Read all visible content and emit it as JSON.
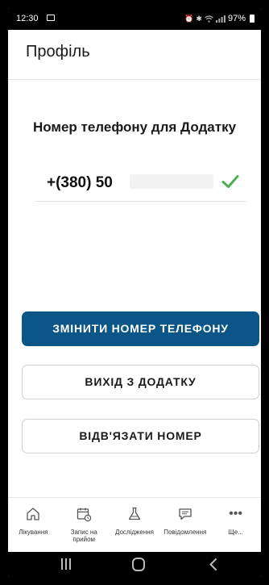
{
  "status_bar": {
    "time": "12:30",
    "battery": "97%",
    "icons": [
      "gallery-icon",
      "alarm-icon",
      "bluetooth-icon",
      "wifi-icon",
      "signal-icon",
      "battery-icon"
    ]
  },
  "app_bar": {
    "title": "Профіль"
  },
  "phone_section": {
    "title": "Номер телефону для Додатку",
    "prefix": "+(380) 50",
    "verified": true,
    "check_color": "#4caf50"
  },
  "buttons": {
    "change_number": "ЗМІНИТИ НОМЕР ТЕЛЕФОНУ",
    "exit_app": "ВИХІД З ДОДАТКУ",
    "unlink_number": "ВІДВ'ЯЗАТИ НОМЕР"
  },
  "bottom_nav": {
    "items": [
      {
        "label": "Лікування",
        "icon": "home-icon"
      },
      {
        "label": "Запис на прийом",
        "icon": "calendar-clock-icon"
      },
      {
        "label": "Дослідження",
        "icon": "flask-icon"
      },
      {
        "label": "Повідомлення",
        "icon": "chat-icon"
      },
      {
        "label": "Ще...",
        "icon": "more-icon"
      }
    ]
  },
  "colors": {
    "primary": "#0b5587",
    "background": "#ffffff",
    "text": "#1a1a1a"
  }
}
